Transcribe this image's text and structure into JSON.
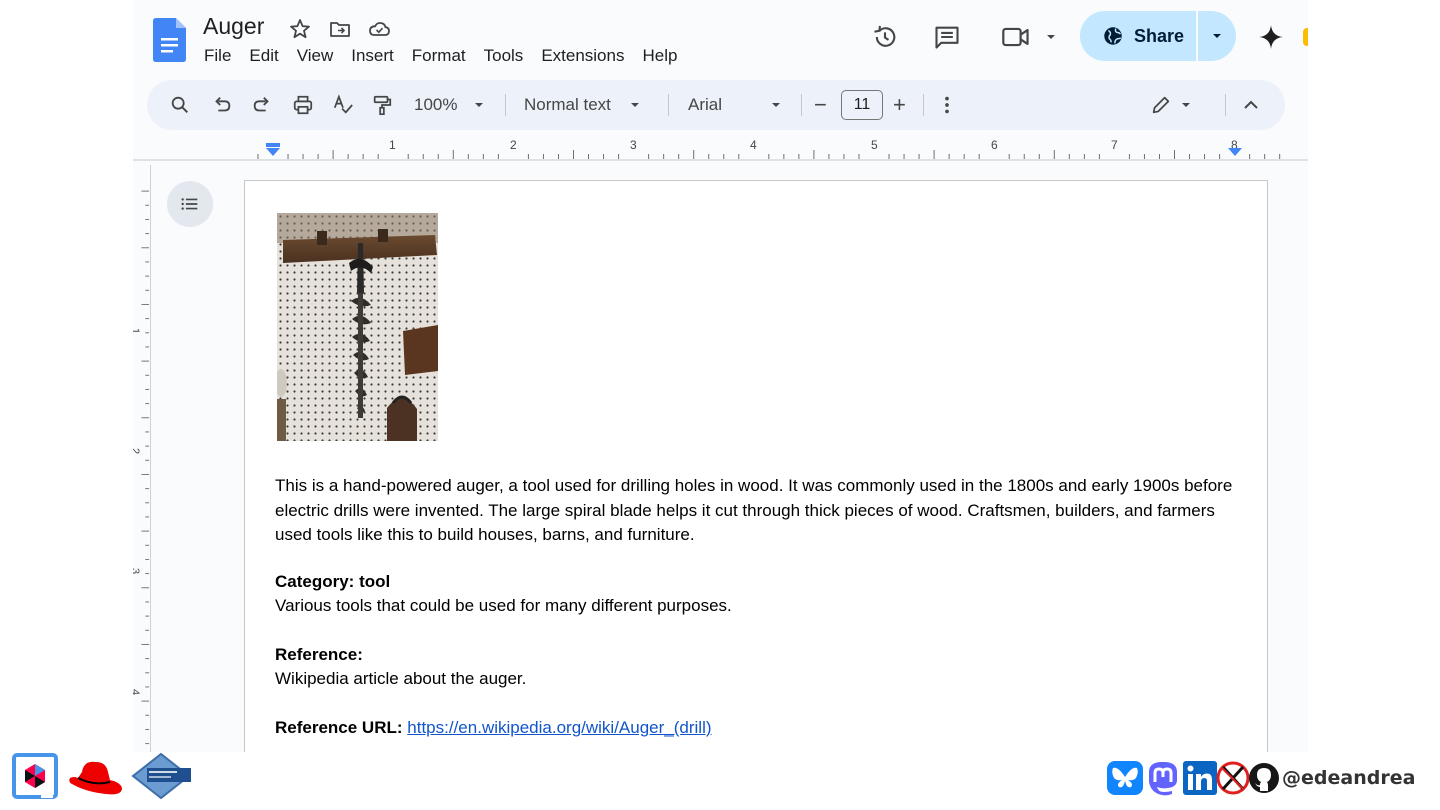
{
  "document": {
    "title": "Auger"
  },
  "menu": [
    "File",
    "Edit",
    "View",
    "Insert",
    "Format",
    "Tools",
    "Extensions",
    "Help"
  ],
  "share": {
    "label": "Share"
  },
  "toolbar": {
    "zoom": "100%",
    "style": "Normal text",
    "font": "Arial",
    "font_size": "11",
    "minus": "−",
    "plus": "+"
  },
  "ruler": {
    "numbers": [
      "1",
      "2",
      "3",
      "4",
      "5",
      "6",
      "7",
      "8"
    ]
  },
  "vruler": {
    "numbers": [
      "1",
      "2",
      "3",
      "4"
    ]
  },
  "content": {
    "description": "This is a hand-powered auger, a tool used for drilling holes in wood. It was commonly used in the 1800s and early 1900s before electric drills were invented. The large spiral blade helps it cut through thick pieces of wood. Craftsmen, builders, and farmers used tools like this to build houses, barns, and furniture.",
    "category_heading": "Category: tool",
    "category_text": "Various tools that could be used for many different purposes.",
    "reference_heading": "Reference:",
    "reference_text": "Wikipedia article about the auger.",
    "url_label": "Reference URL:",
    "url": "https://en.wikipedia.org/wiki/Auger_(drill)"
  },
  "footer": {
    "handle": "@edeandrea"
  },
  "icons": {
    "doc": "google-docs-icon",
    "star": "star-icon",
    "move": "move-to-folder-icon",
    "cloud": "cloud-saved-icon",
    "history": "version-history-icon",
    "comments": "comments-icon",
    "meet": "video-call-icon",
    "gemini": "gemini-sparkle-icon"
  },
  "colors": {
    "share_bg": "#c2e7ff",
    "toolbar_bg": "#edf2fa",
    "link": "#1155cc",
    "docs_blue": "#4285f4"
  }
}
